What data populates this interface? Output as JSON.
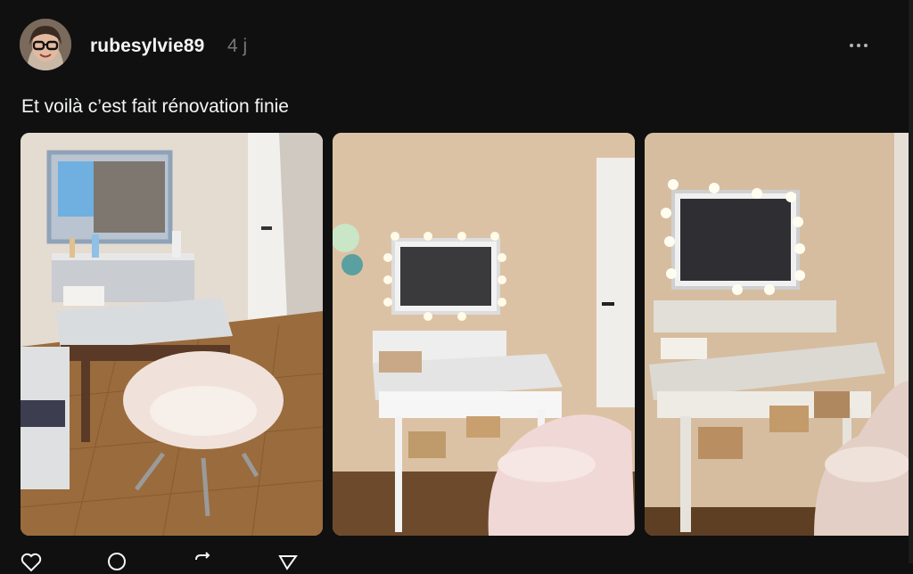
{
  "post": {
    "author": {
      "username": "rubesylvie89",
      "avatar_icon": "avatar-photo"
    },
    "timestamp": "4 j",
    "more_icon": "more-dots-icon",
    "caption": "Et voilà c’est fait rénovation finie",
    "photos": [
      {
        "name": "photo-vanity-daylight"
      },
      {
        "name": "photo-vanity-lights-on"
      },
      {
        "name": "photo-vanity-closeup"
      }
    ],
    "actions": [
      {
        "icon": "heart-icon"
      },
      {
        "icon": "comment-icon"
      },
      {
        "icon": "repost-icon"
      },
      {
        "icon": "share-icon"
      }
    ]
  },
  "colors": {
    "background": "#101010",
    "text_primary": "#f3f5f7",
    "text_secondary": "#777777"
  }
}
